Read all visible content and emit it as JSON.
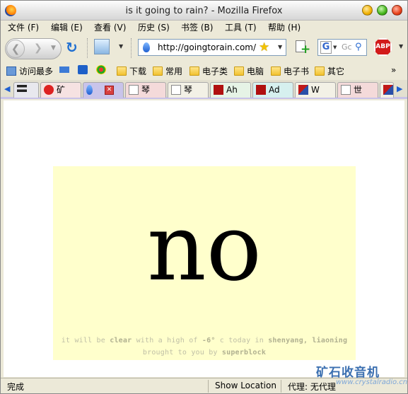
{
  "window": {
    "title": "is it going to rain? - Mozilla Firefox"
  },
  "menu": [
    "文件 (F)",
    "编辑 (E)",
    "查看 (V)",
    "历史 (S)",
    "书签 (B)",
    "工具 (T)",
    "帮助 (H)"
  ],
  "nav": {
    "url": "http://goingtorain.com/",
    "search_placeholder": "Gc",
    "search_engine": "G",
    "adblock_label": "ABP"
  },
  "bookmarks": {
    "most_visited": "访问最多",
    "folders": [
      "下载",
      "常用",
      "电子类",
      "电脑",
      "电子书",
      "其它"
    ],
    "more": "»"
  },
  "tabs": [
    {
      "label": "矿"
    },
    {
      "label": ""
    },
    {
      "label": "琴"
    },
    {
      "label": "琴"
    },
    {
      "label": "Ah"
    },
    {
      "label": "Ad"
    },
    {
      "label": "W"
    },
    {
      "label": "世"
    }
  ],
  "page": {
    "answer": "no",
    "caption_line1_pre": "it will be ",
    "caption_weather": "clear",
    "caption_line1_mid": " with a high of ",
    "caption_temp": "-6°",
    "caption_line1_post": " c today in ",
    "caption_city": "shenyang, liaoning",
    "caption_line2_pre": "brought to you by ",
    "caption_brand": "superblock"
  },
  "status": {
    "text": "完成",
    "show_location": "Show Location",
    "proxy": "代理: 无代理"
  },
  "watermark": {
    "cn": "矿石收音机",
    "en": "www.crystalradio.cn"
  },
  "colors": {
    "panel": "#ffffcc",
    "caption": "#bfbfa6",
    "tab_active": "#c9c4ea"
  }
}
